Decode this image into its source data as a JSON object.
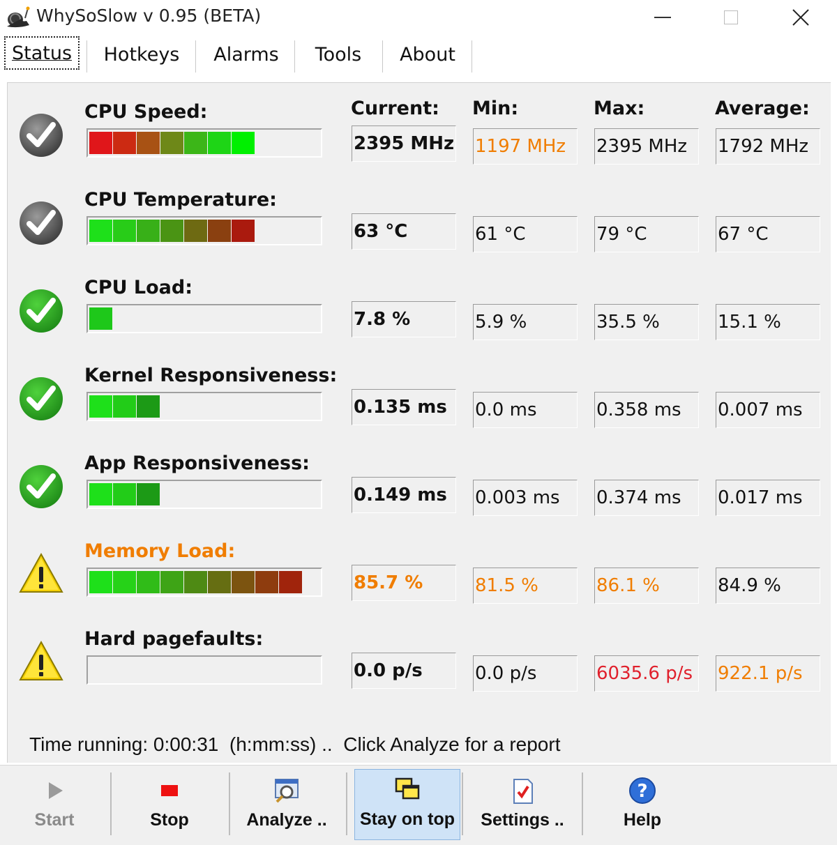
{
  "window": {
    "title": "WhySoSlow v 0.95  (BETA)"
  },
  "tabs": [
    {
      "label": "Status",
      "active": true
    },
    {
      "label": "Hotkeys"
    },
    {
      "label": "Alarms"
    },
    {
      "label": "Tools"
    },
    {
      "label": "About"
    }
  ],
  "columns": {
    "current": "Current:",
    "min": "Min:",
    "max": "Max:",
    "average": "Average:"
  },
  "colors": {
    "orange": "#f07d00",
    "red": "#e0202c",
    "normal": "#111111"
  },
  "metrics": [
    {
      "label": "CPU Speed:",
      "status": "check-gray",
      "label_color": "normal",
      "current": "2395 MHz",
      "min": "1197 MHz",
      "max": "2395 MHz",
      "average": "1792 MHz",
      "min_color": "orange",
      "max_color": "normal",
      "avg_color": "normal",
      "cur_color": "normal",
      "bar_segments": [
        "#e0161a",
        "#cc2a12",
        "#a85214",
        "#6e8818",
        "#3cb618",
        "#1ed516",
        "#00f000"
      ]
    },
    {
      "label": "CPU Temperature:",
      "status": "check-gray",
      "label_color": "normal",
      "current": "63 °C",
      "min": "61 °C",
      "max": "79 °C",
      "average": "67 °C",
      "min_color": "normal",
      "max_color": "normal",
      "avg_color": "normal",
      "cur_color": "normal",
      "bar_segments": [
        "#1ee01a",
        "#28cc18",
        "#38b018",
        "#4a9414",
        "#6e6a12",
        "#8a4010",
        "#aa1a0e"
      ]
    },
    {
      "label": "CPU Load:",
      "status": "check-green",
      "label_color": "normal",
      "current": "7.8 %",
      "min": "5.9 %",
      "max": "35.5 %",
      "average": "15.1 %",
      "min_color": "normal",
      "max_color": "normal",
      "avg_color": "normal",
      "cur_color": "normal",
      "bar_segments": [
        "#1ec81a"
      ]
    },
    {
      "label": "Kernel Responsiveness:",
      "status": "check-green",
      "label_color": "normal",
      "current": "0.135 ms",
      "min": "0.0 ms",
      "max": "0.358 ms",
      "average": "0.007 ms",
      "min_color": "normal",
      "max_color": "normal",
      "avg_color": "normal",
      "cur_color": "normal",
      "bar_segments": [
        "#1ee01a",
        "#22cc18",
        "#1c9a16"
      ]
    },
    {
      "label": "App Responsiveness:",
      "status": "check-green",
      "label_color": "normal",
      "current": "0.149 ms",
      "min": "0.003 ms",
      "max": "0.374 ms",
      "average": "0.017 ms",
      "min_color": "normal",
      "max_color": "normal",
      "avg_color": "normal",
      "cur_color": "normal",
      "bar_segments": [
        "#1ee01a",
        "#22cc18",
        "#1c9a16"
      ]
    },
    {
      "label": "Memory Load:",
      "status": "warning",
      "label_color": "orange",
      "current": "85.7 %",
      "min": "81.5 %",
      "max": "86.1 %",
      "average": "84.9 %",
      "min_color": "orange",
      "max_color": "orange",
      "avg_color": "normal",
      "cur_color": "orange",
      "bar_segments": [
        "#1ee01a",
        "#26d218",
        "#30bc18",
        "#3ea416",
        "#4e8a14",
        "#666e12",
        "#7c5410",
        "#8e3c0e",
        "#a0240c"
      ]
    },
    {
      "label": "Hard pagefaults:",
      "status": "warning",
      "label_color": "normal",
      "current": "0.0 p/s",
      "min": "0.0 p/s",
      "max": "6035.6 p/s",
      "average": "922.1 p/s",
      "min_color": "normal",
      "max_color": "red",
      "avg_color": "orange",
      "cur_color": "normal",
      "bar_segments": []
    }
  ],
  "status_line": "Time running: 0:00:31  (h:mm:ss) ..  Click Analyze for a report",
  "toolbar": [
    {
      "label": "Start",
      "icon": "play-icon",
      "enabled": false
    },
    {
      "label": "Stop",
      "icon": "stop-icon",
      "enabled": true
    },
    {
      "label": "Analyze ..",
      "icon": "analyze-icon",
      "enabled": true
    },
    {
      "label": "Stay on top",
      "icon": "stay-on-top-icon",
      "enabled": true,
      "pressed": true
    },
    {
      "label": "Settings ..",
      "icon": "settings-icon",
      "enabled": true
    },
    {
      "label": "Help",
      "icon": "help-icon",
      "enabled": true
    }
  ]
}
